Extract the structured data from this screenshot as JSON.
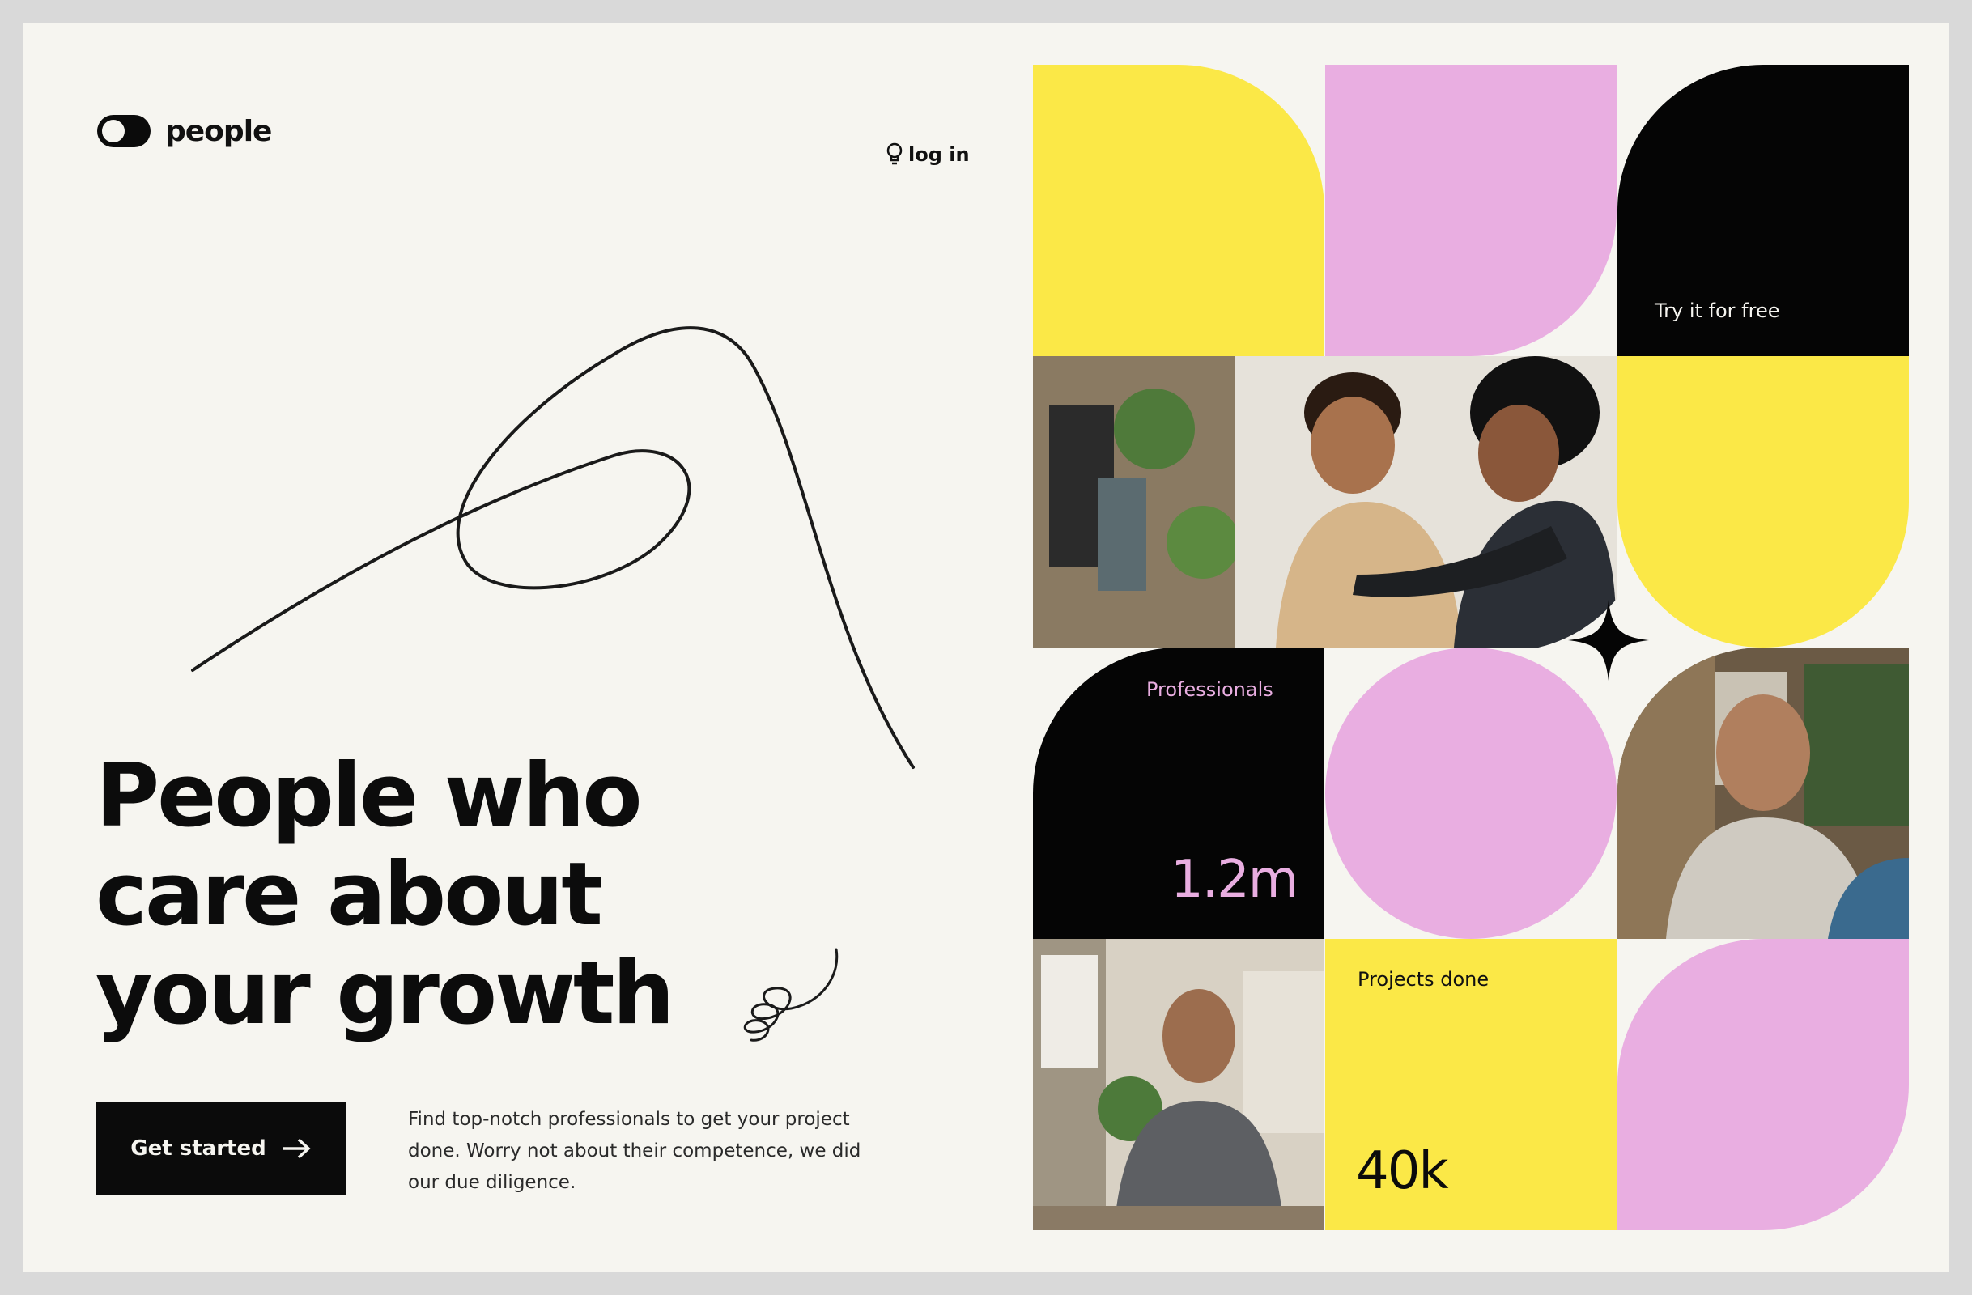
{
  "brand": {
    "name": "people",
    "logo_icon": "toggle-logo-icon"
  },
  "nav": {
    "login_label": "log in",
    "login_icon": "lightbulb-icon"
  },
  "hero": {
    "headline": [
      "People who",
      "care about",
      "your growth"
    ],
    "cta_label": "Get started",
    "cta_icon": "arrow-right-icon",
    "description": "Find top-notch professionals to get your project done. Worry not about their competence, we did our due diligence."
  },
  "tiles": {
    "try_free_label": "Try it for free",
    "professionals_label": "Professionals",
    "professionals_value": "1.2m",
    "projects_label": "Projects done",
    "projects_value": "40k"
  },
  "colors": {
    "background": "#f6f5f0",
    "yellow": "#fbe847",
    "pink": "#e9aee1",
    "black": "#050505",
    "pink_text": "#e9aee1"
  }
}
